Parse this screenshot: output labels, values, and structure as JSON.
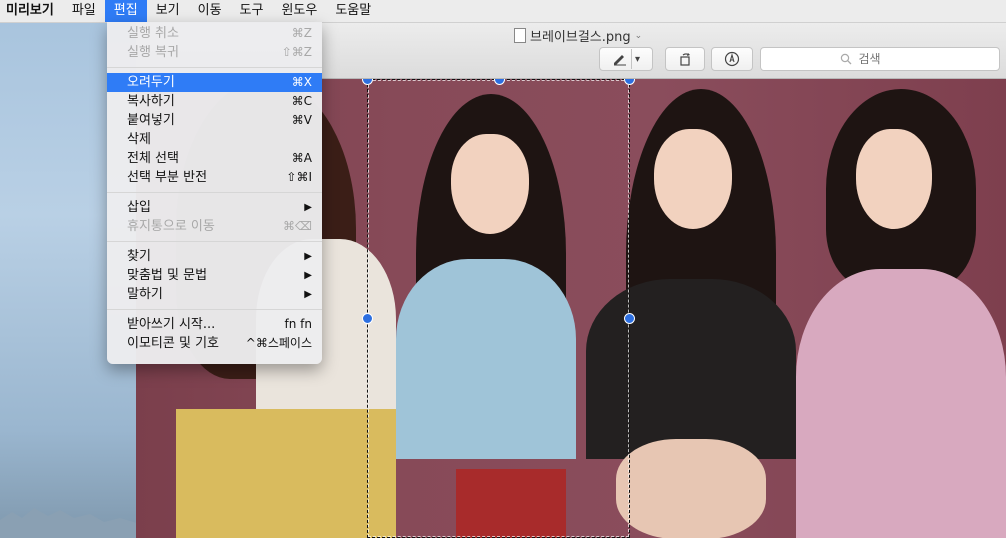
{
  "menubar": {
    "items": [
      "미리보기",
      "파일",
      "편집",
      "보기",
      "이동",
      "도구",
      "윈도우",
      "도움말"
    ],
    "active_index": 2
  },
  "window": {
    "title": "브레이브걸스.png",
    "search_placeholder": "검색"
  },
  "edit_menu": {
    "undo": {
      "label": "실행 취소",
      "shortcut": "⌘Z"
    },
    "redo": {
      "label": "실행 복귀",
      "shortcut": "⇧⌘Z"
    },
    "cut": {
      "label": "오려두기",
      "shortcut": "⌘X"
    },
    "copy": {
      "label": "복사하기",
      "shortcut": "⌘C"
    },
    "paste": {
      "label": "붙여넣기",
      "shortcut": "⌘V"
    },
    "delete": {
      "label": "삭제"
    },
    "select_all": {
      "label": "전체 선택",
      "shortcut": "⌘A"
    },
    "invert_selection": {
      "label": "선택 부분 반전",
      "shortcut": "⇧⌘I"
    },
    "insert": {
      "label": "삽입",
      "arrow": "▶"
    },
    "move_to_trash": {
      "label": "휴지통으로 이동",
      "shortcut": "⌘⌫"
    },
    "find": {
      "label": "찾기",
      "arrow": "▶"
    },
    "spelling": {
      "label": "맞춤법 및 문법",
      "arrow": "▶"
    },
    "speech": {
      "label": "말하기",
      "arrow": "▶"
    },
    "dictation": {
      "label": "받아쓰기 시작...",
      "shortcut": "fn fn"
    },
    "emoji": {
      "label": "이모티콘 및 기호",
      "shortcut": "^⌘스페이스"
    }
  },
  "colors": {
    "highlight": "#2f7cf6",
    "selection_handle": "#2d6fe0"
  }
}
